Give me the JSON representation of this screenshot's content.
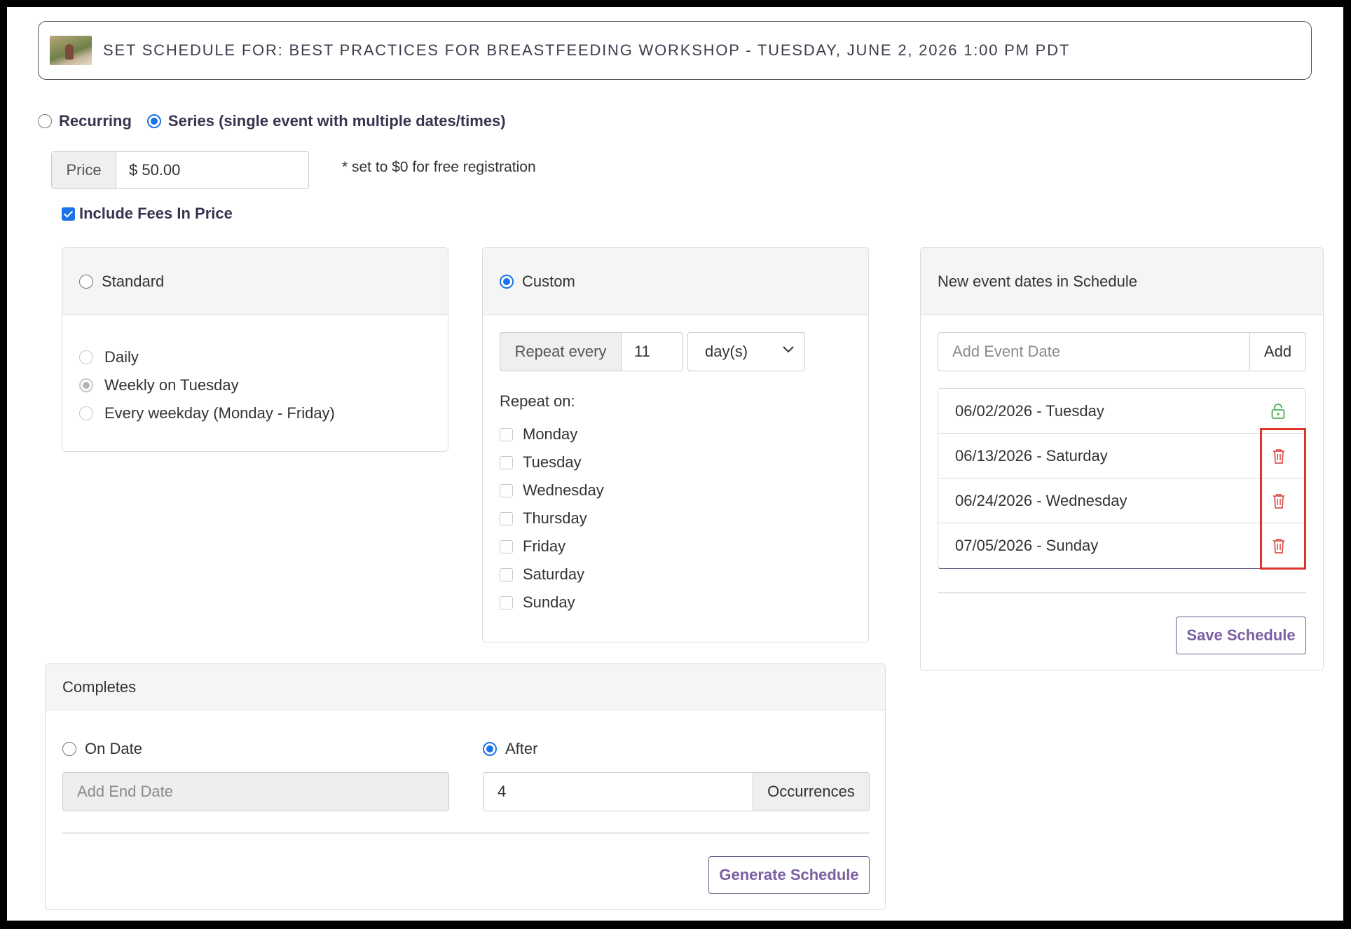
{
  "header": {
    "title": "SET SCHEDULE FOR: BEST PRACTICES FOR BREASTFEEDING WORKSHOP - TUESDAY, JUNE 2, 2026 1:00 PM PDT"
  },
  "schedule_type": {
    "recurring_label": "Recurring",
    "series_label": "Series (single event with multiple dates/times)",
    "selected": "series"
  },
  "price": {
    "label": "Price",
    "value": "$ 50.00",
    "note": "* set to $0 for free registration"
  },
  "fees": {
    "label": "Include Fees In Price",
    "checked": true
  },
  "standard": {
    "label": "Standard",
    "options": [
      "Daily",
      "Weekly on Tuesday",
      "Every weekday (Monday - Friday)"
    ]
  },
  "custom": {
    "label": "Custom",
    "repeat_label": "Repeat every",
    "repeat_value": "11",
    "repeat_unit": "day(s)",
    "repeat_on_label": "Repeat on:",
    "days": [
      "Monday",
      "Tuesday",
      "Wednesday",
      "Thursday",
      "Friday",
      "Saturday",
      "Sunday"
    ]
  },
  "dates_panel": {
    "title": "New event dates in Schedule",
    "add_placeholder": "Add Event Date",
    "add_button": "Add",
    "dates": [
      {
        "label": "06/02/2026 - Tuesday",
        "icon": "lock-icon"
      },
      {
        "label": "06/13/2026 - Saturday",
        "icon": "trash-icon"
      },
      {
        "label": "06/24/2026 - Wednesday",
        "icon": "trash-icon"
      },
      {
        "label": "07/05/2026 - Sunday",
        "icon": "trash-icon"
      }
    ],
    "save_button": "Save Schedule"
  },
  "completes": {
    "title": "Completes",
    "on_date_label": "On Date",
    "end_date_placeholder": "Add End Date",
    "after_label": "After",
    "occurrences_value": "4",
    "occurrences_label": "Occurrences",
    "generate_button": "Generate Schedule"
  },
  "colors": {
    "accent": "#1a73e8",
    "button_text": "#7b5fa2",
    "lock": "#4caf50",
    "trash": "#d9534f",
    "highlight": "#e0342a"
  }
}
